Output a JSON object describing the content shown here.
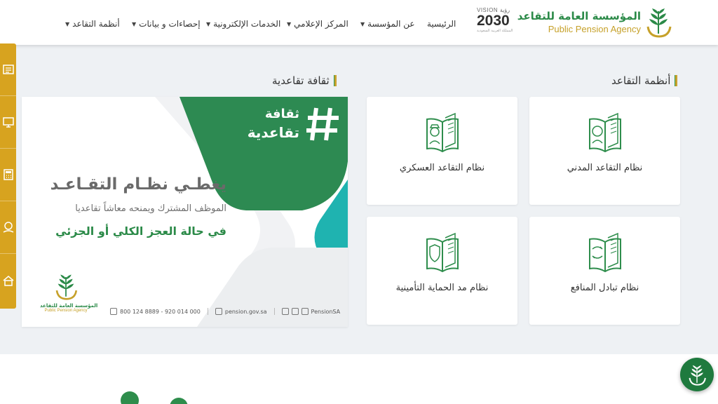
{
  "header": {
    "logo_ar": "المؤسسة العامة للتقاعد",
    "logo_en": "Public Pension Agency",
    "vision_top": "VISION رؤية",
    "vision_year": "2030",
    "vision_sub": "المملكة العربية السعودية",
    "nav": [
      {
        "label": "الرئيسية"
      },
      {
        "label": "عن المؤسسة",
        "dropdown": true
      },
      {
        "label": "المركز الإعلامي",
        "dropdown": true
      },
      {
        "label": "الخدمات الإلكترونية",
        "dropdown": true
      },
      {
        "label": "إحصاءات و بيانات",
        "dropdown": true
      },
      {
        "label": "أنظمة التقاعد",
        "dropdown": true
      }
    ]
  },
  "sidebar": {
    "icons": [
      "form-icon",
      "monitor-icon",
      "calculator-icon",
      "hand-coin-icon",
      "house-icon"
    ],
    "accent": "#d7a31f"
  },
  "sections": {
    "systems_title": "أنظمة التقاعد",
    "culture_title": "ثقافة تقاعدية"
  },
  "banner": {
    "hash_line1": "ثقافة",
    "hash_line2": "تقاعدية",
    "title": "يغطـي نظـام التقـاعـد",
    "subtitle": "الموظف المشترك ويمنحه معاشاً تقاعديا",
    "emphasis": "في حالة العجز الكلي أو الجزئي",
    "logo_ar": "المؤسسة العامة للتقاعد",
    "logo_en": "Public Pension Agency",
    "phone": "800 124 8889 - 920 014 000",
    "website": "pension.gov.sa",
    "handle": "PensionSA"
  },
  "cards": [
    {
      "label": "نظام التقاعد المدني",
      "icon": "civil-retirement-book-icon"
    },
    {
      "label": "نظام التقاعد العسكري",
      "icon": "military-retirement-book-icon"
    },
    {
      "label": "نظام تبادل المنافع",
      "icon": "benefits-exchange-book-icon"
    },
    {
      "label": "نظام مد الحماية التأمينية",
      "icon": "insurance-protection-book-icon"
    }
  ],
  "colors": {
    "brand_green": "#2b8a48",
    "brand_gold": "#c9a12d",
    "teal": "#1fb3b0"
  }
}
